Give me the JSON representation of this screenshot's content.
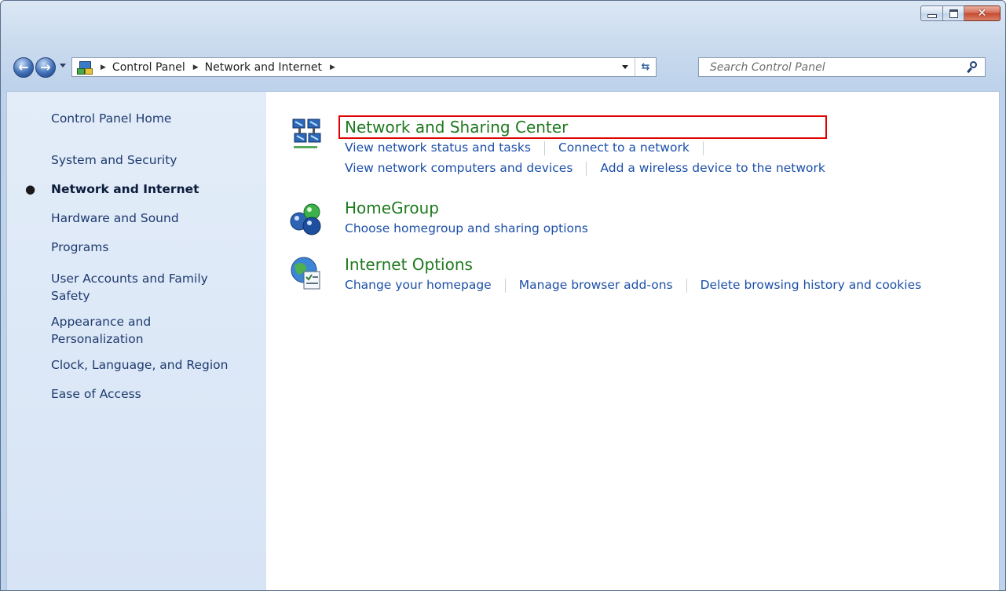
{
  "window": {
    "caption_buttons": {
      "minimize": "minimize",
      "maximize": "maximize",
      "close": "✕"
    }
  },
  "navbar": {
    "breadcrumbs": [
      "Control Panel",
      "Network and Internet"
    ],
    "search_placeholder": "Search Control Panel"
  },
  "sidebar": {
    "items": [
      {
        "label": "Control Panel Home"
      },
      {
        "label": "System and Security"
      },
      {
        "label": "Network and Internet",
        "current": true
      },
      {
        "label": "Hardware and Sound"
      },
      {
        "label": "Programs"
      },
      {
        "label": "User Accounts and Family Safety"
      },
      {
        "label": "Appearance and Personalization"
      },
      {
        "label": "Clock, Language, and Region"
      },
      {
        "label": "Ease of Access"
      }
    ]
  },
  "categories": [
    {
      "title": "Network and Sharing Center",
      "icon": "network-icon",
      "links_row1": [
        "View network status and tasks",
        "Connect to a network"
      ],
      "links_row2": [
        "View network computers and devices",
        "Add a wireless device to the network"
      ]
    },
    {
      "title": "HomeGroup",
      "icon": "homegroup-icon",
      "links_row1": [
        "Choose homegroup and sharing options"
      ]
    },
    {
      "title": "Internet Options",
      "icon": "internet-options-icon",
      "links_row1": [
        "Change your homepage",
        "Manage browser add-ons",
        "Delete browsing history and cookies"
      ]
    }
  ],
  "colors": {
    "category_title": "#1e7a1e",
    "link": "#1c4fa8",
    "highlight_box": "#e00000"
  }
}
